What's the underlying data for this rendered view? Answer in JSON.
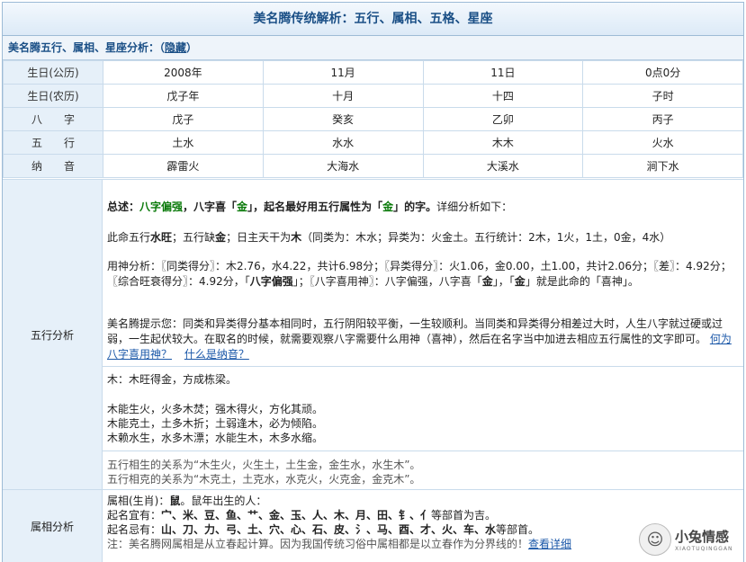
{
  "title": "美名腾传统解析：五行、属相、五格、星座",
  "subhead": {
    "label": "美名腾五行、属相、星座分析：（",
    "link": "隐藏",
    "close": "）"
  },
  "rows": [
    {
      "label": "生日(公历)",
      "cells": [
        "2008年",
        "11月",
        "11日",
        "0点0分"
      ]
    },
    {
      "label": "生日(农历)",
      "cells": [
        "戊子年",
        "十月",
        "十四",
        "子时"
      ]
    },
    {
      "label": "八　　字",
      "cells": [
        "戊子",
        "癸亥",
        "乙卯",
        "丙子"
      ]
    },
    {
      "label": "五　　行",
      "cells": [
        "土水",
        "水水",
        "木木",
        "火水"
      ]
    },
    {
      "label": "纳　　音",
      "cells": [
        "霹雷火",
        "大海水",
        "大溪水",
        "涧下水"
      ]
    }
  ],
  "wuxing": {
    "label": "五行分析",
    "summary_prefix": "总述：",
    "summary_a": "八字偏强",
    "summary_b": "，八字喜「",
    "summary_c": "金",
    "summary_d": "」，起名最好用五行属性为「",
    "summary_e": "金",
    "summary_f": "」的字。",
    "summary_tail": "详细分析如下：",
    "line2_a": "此命五行",
    "line2_b": "水旺",
    "line2_c": "；五行缺",
    "line2_d": "金",
    "line2_e": "；日主天干为",
    "line2_f": "木",
    "line2_g": "（同类为：木水；异类为：火金土。五行统计：2木，1火，1土，0金，4水）",
    "score_text_1": "用神分析：〖同类得分〗：木2.76，水4.22，共计6.98分；〖异类得分〗：火1.06，金0.00，土1.00，共计2.06分；〖差〗：4.92分；〖综合旺衰得分〗：4.92分，「",
    "score_bold": "八字偏强",
    "score_text_2": "」；〖八字喜用神〗：八字偏强，八字喜「",
    "score_jin1": "金",
    "score_text_3": "」，「",
    "score_jin2": "金",
    "score_text_4": "」就是此命的「喜神」。",
    "tip_text": "美名腾提示您：同类和异类得分基本相同时，五行阴阳较平衡，一生较顺利。当同类和异类得分相差过大时，人生八字就过硬或过弱，一生起伏较大。在取名的时候，就需要观察八字需要什么用神（喜神），然后在名字当中加进去相应五行属性的文字即可。",
    "link1": "何为八字喜用神？",
    "link2": "什么是纳音？",
    "wood": "木：木旺得金，方成栋梁。",
    "wood_lines": [
      "木能生火，火多木焚；强木得火，方化其顽。",
      "木能克土，土多木折；土弱逢木，必为倾陷。",
      "木赖水生，水多木漂；水能生木，木多水缩。"
    ],
    "relations": [
      "五行相生的关系为“木生火，火生土，土生金，金生水，水生木”。",
      "五行相克的关系为“木克土，土克水，水克火，火克金，金克木”。"
    ]
  },
  "shuxiang": {
    "label": "属相分析",
    "line1_a": "属相(生肖)：",
    "line1_b": "鼠",
    "line1_c": "。鼠年出生的人：",
    "line2_a": "起名宜有：",
    "line2_b": "宀、米、豆、鱼、艹、金、玉、人、木、月、田、钅、亻",
    "line2_c": "等部首为吉。",
    "line3_a": "起名忌有：",
    "line3_b": "山、刀、力、弓、土、穴、心、石、皮、氵、马、酉、才、火、车、水",
    "line3_c": "等部首。",
    "note": "注：美名腾网属相是从立春起计算。因为我国传统习俗中属相都是以立春作为分界线的！",
    "note_link": "查看详细"
  },
  "watermark": {
    "cn": "小兔情感",
    "en": "XIAOTUQINGGAN"
  }
}
